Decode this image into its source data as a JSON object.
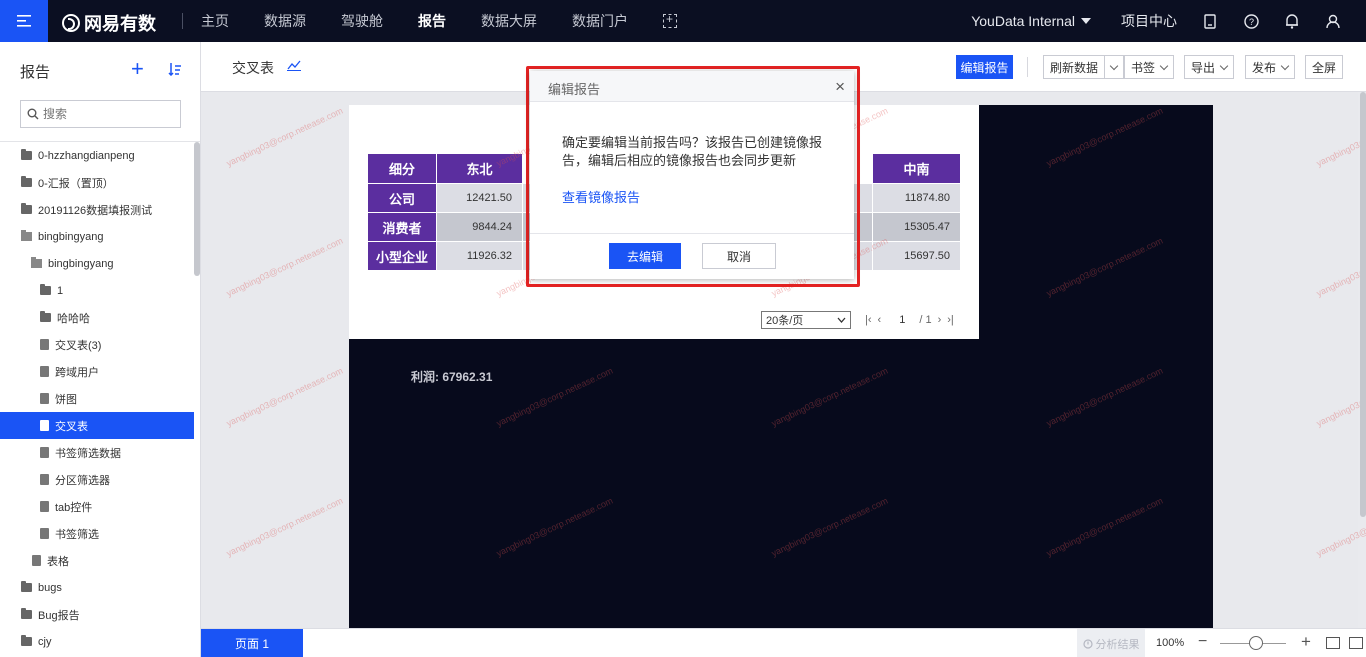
{
  "app": {
    "logo_text": "网易有数"
  },
  "nav": {
    "items": [
      {
        "label": "主页",
        "active": false
      },
      {
        "label": "数据源",
        "active": false
      },
      {
        "label": "驾驶舱",
        "active": false
      },
      {
        "label": "报告",
        "active": true
      },
      {
        "label": "数据大屏",
        "active": false
      },
      {
        "label": "数据门户",
        "active": false
      }
    ],
    "workspace": "YouData Internal",
    "project_center": "项目中心"
  },
  "sidebar": {
    "title": "报告",
    "search_placeholder": "搜索",
    "tree": [
      {
        "label": "0-hzzhangdianpeng",
        "type": "folder",
        "level": 0
      },
      {
        "label": "0-汇报（置顶）",
        "type": "folder",
        "level": 0
      },
      {
        "label": "20191126数据填报测试",
        "type": "folder",
        "level": 0
      },
      {
        "label": "bingbingyang",
        "type": "folder-open",
        "level": 0
      },
      {
        "label": "bingbingyang",
        "type": "folder-open",
        "level": 1
      },
      {
        "label": "1",
        "type": "folder",
        "level": 2
      },
      {
        "label": "哈哈哈",
        "type": "folder",
        "level": 2
      },
      {
        "label": "交叉表(3)",
        "type": "doc",
        "level": 2
      },
      {
        "label": "跨域用户",
        "type": "doc",
        "level": 2
      },
      {
        "label": "饼图",
        "type": "doc",
        "level": 2
      },
      {
        "label": "交叉表",
        "type": "doc",
        "level": 2,
        "active": true
      },
      {
        "label": "书签筛选数据",
        "type": "doc",
        "level": 2
      },
      {
        "label": "分区筛选器",
        "type": "doc",
        "level": 2
      },
      {
        "label": "tab控件",
        "type": "doc",
        "level": 2
      },
      {
        "label": "书签筛选",
        "type": "doc",
        "level": 2
      },
      {
        "label": "表格",
        "type": "doc",
        "level": 1
      },
      {
        "label": "bugs",
        "type": "folder",
        "level": 0
      },
      {
        "label": "Bug报告",
        "type": "folder",
        "level": 0
      },
      {
        "label": "cjy",
        "type": "folder",
        "level": 0
      }
    ]
  },
  "header": {
    "report_title": "交叉表",
    "edit_report": "编辑报告",
    "refresh": "刷新数据",
    "bookmark": "书签",
    "export": "导出",
    "publish": "发布",
    "fullscreen": "全屏"
  },
  "table": {
    "headers": [
      "细分",
      "东北",
      "中南"
    ],
    "rows": [
      {
        "label": "公司",
        "v1": "12421.50",
        "v2": "11874.80"
      },
      {
        "label": "消费者",
        "v1": "9844.24",
        "v2": "15305.47"
      },
      {
        "label": "小型企业",
        "v1": "11926.32",
        "v2": "15697.50"
      }
    ]
  },
  "pager": {
    "page_size": "20条/页",
    "current": "1",
    "total": "/ 1"
  },
  "profit": "利润:  67962.31",
  "bottom": {
    "page_tab": "页面 1",
    "analysis": "分析结果",
    "zoom": "100%"
  },
  "modal": {
    "title": "编辑报告",
    "message": "确定要编辑当前报告吗？该报告已创建镜像报告，编辑后相应的镜像报告也会同步更新",
    "link": "查看镜像报告",
    "confirm": "去编辑",
    "cancel": "取消"
  },
  "watermark": "yangbing03@corp.netease.com"
}
